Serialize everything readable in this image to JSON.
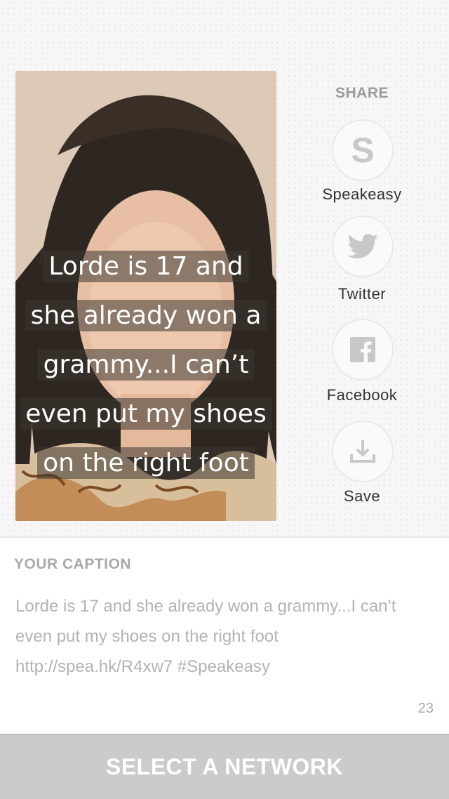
{
  "card": {
    "quote_lines": [
      "Lorde is 17 and",
      "she already won a",
      "grammy...I can’t",
      "even put my shoes",
      "on the right foot"
    ]
  },
  "share": {
    "title": "SHARE",
    "items": [
      {
        "label": "Speakeasy",
        "icon": "speakeasy-s-icon"
      },
      {
        "label": "Twitter",
        "icon": "twitter-bird-icon"
      },
      {
        "label": "Facebook",
        "icon": "facebook-f-icon"
      },
      {
        "label": "Save",
        "icon": "download-tray-icon"
      }
    ]
  },
  "caption": {
    "title": "YOUR CAPTION",
    "text": "Lorde is 17 and she already won a grammy...I can’t even put my shoes on the right foot http://spea.hk/R4xw7 #Speakeasy",
    "count": "23"
  },
  "footer": {
    "button_label": "SELECT A NETWORK"
  },
  "colors": {
    "icon_gray": "#c8c8c8",
    "button_bg": "#cbcbcb"
  }
}
